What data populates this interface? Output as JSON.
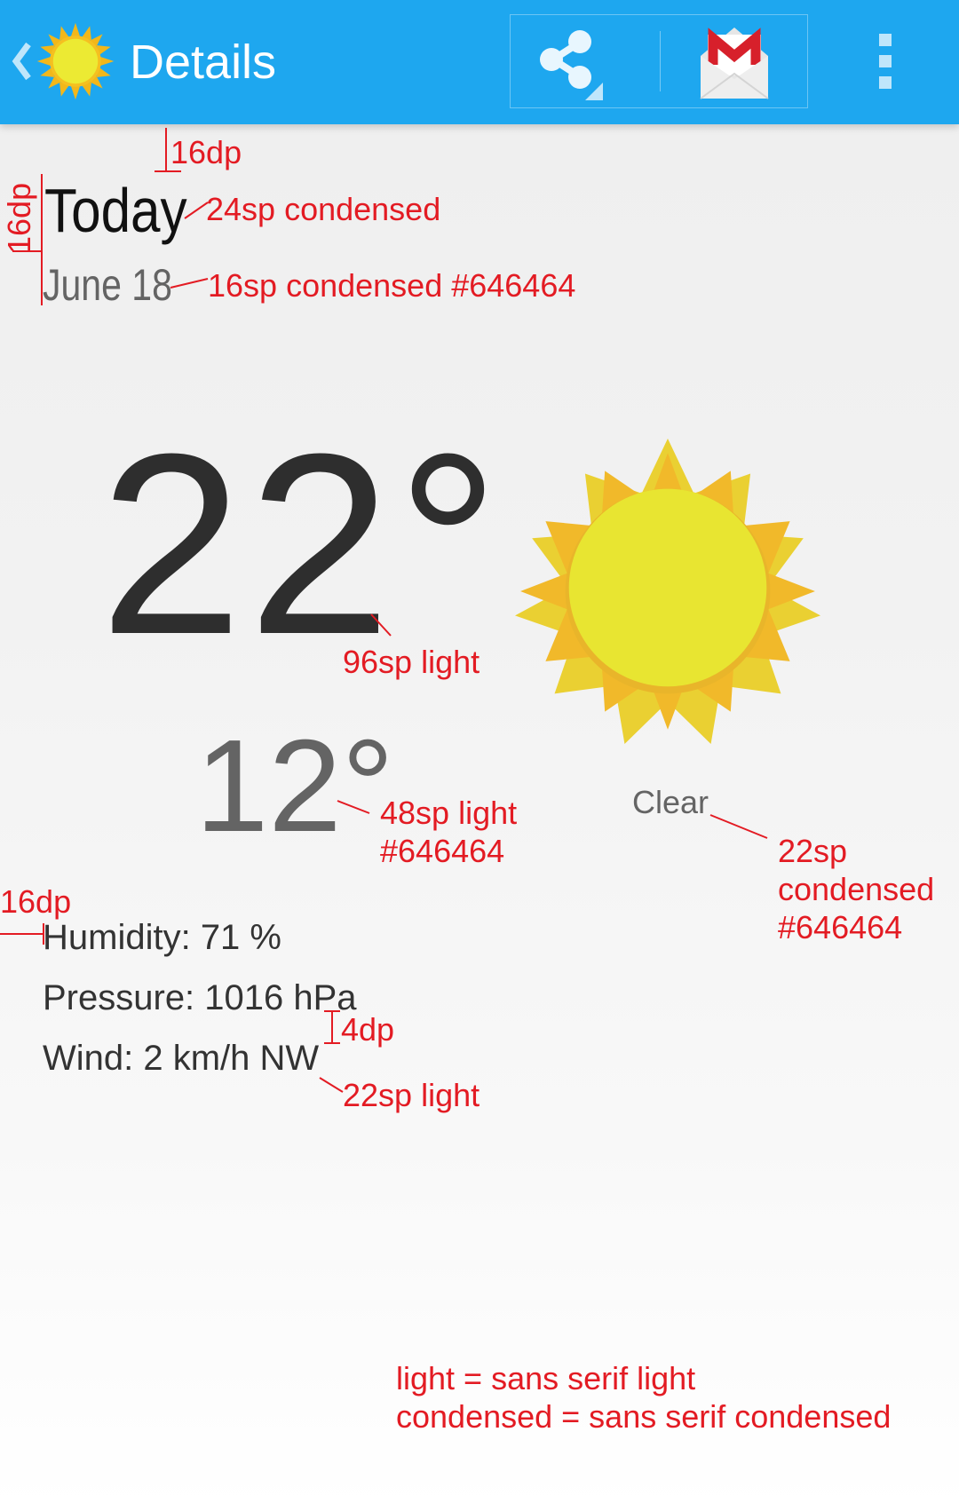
{
  "action_bar": {
    "title": "Details",
    "background_color": "#1ea7ef",
    "up_icon": "chevron-left-icon",
    "app_icon": "sun-icon",
    "actions": [
      {
        "name": "share",
        "icon": "share-icon"
      },
      {
        "name": "gmail",
        "icon": "gmail-icon"
      },
      {
        "name": "overflow",
        "icon": "overflow-menu-icon"
      }
    ]
  },
  "forecast": {
    "day": "Today",
    "date": "June 18",
    "high": "22°",
    "low": "12°",
    "condition": "Clear",
    "icon": "sun-icon",
    "humidity": "Humidity: 71 %",
    "pressure": "Pressure: 1016 hPa",
    "wind": "Wind: 2 km/h NW"
  },
  "annotations": {
    "top_margin": "16dp",
    "left_margin": "16dp",
    "day_spec": "24sp condensed",
    "date_spec": "16sp condensed #646464",
    "high_spec": "96sp light",
    "low_spec_line1": "48sp light",
    "low_spec_line2": "#646464",
    "condition_spec_line1": "22sp",
    "condition_spec_line2": "condensed",
    "condition_spec_line3": "#646464",
    "details_left_margin": "16dp",
    "line_spacing": "4dp",
    "details_spec": "22sp light",
    "legend_line1": "light = sans serif light",
    "legend_line2": "condensed = sans serif condensed",
    "annotation_color": "#e31b23",
    "secondary_text_color": "#646464"
  }
}
